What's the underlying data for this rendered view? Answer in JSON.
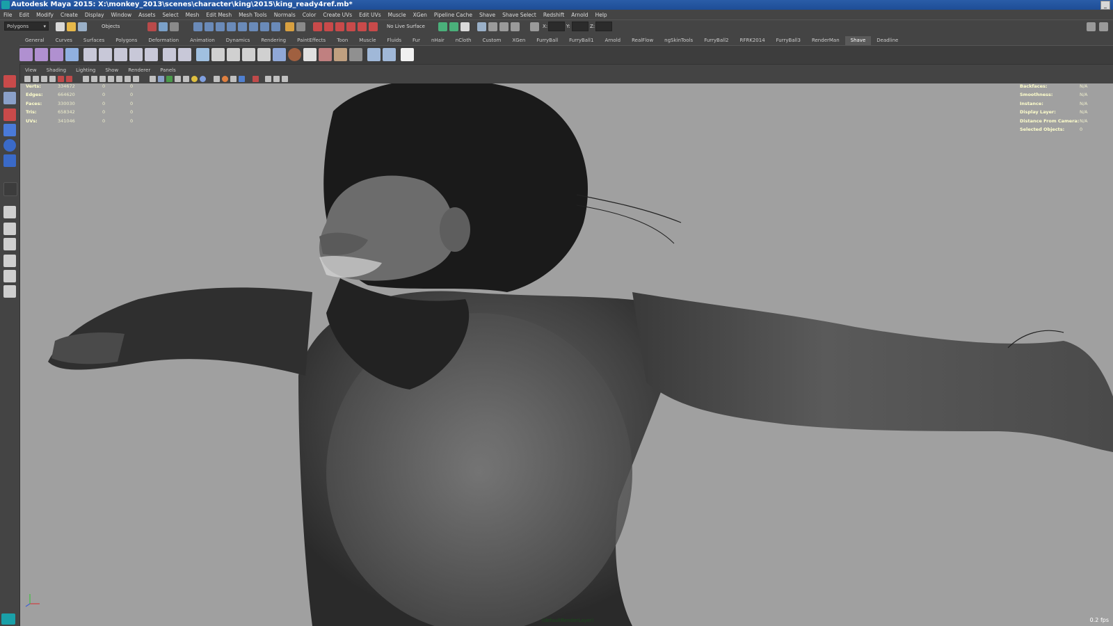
{
  "window": {
    "title": "Autodesk Maya 2015: X:\\monkey_2013\\scenes\\character\\king\\2015\\king_ready4ref.mb*"
  },
  "menu": [
    "File",
    "Edit",
    "Modify",
    "Create",
    "Display",
    "Window",
    "Assets",
    "Select",
    "Mesh",
    "Edit Mesh",
    "Mesh Tools",
    "Normals",
    "Color",
    "Create UVs",
    "Edit UVs",
    "Muscle",
    "XGen",
    "Pipeline Cache",
    "Shave",
    "Shave Select",
    "Redshift",
    "Arnold",
    "Help"
  ],
  "status_line": {
    "menuset": "Polygons",
    "selection_mode": "Objects",
    "live_surface": "No Live Surface",
    "x_label": "X:",
    "y_label": "Y:",
    "z_label": "Z:"
  },
  "shelf_tabs": [
    "General",
    "Curves",
    "Surfaces",
    "Polygons",
    "Deformation",
    "Animation",
    "Dynamics",
    "Rendering",
    "PaintEffects",
    "Toon",
    "Muscle",
    "Fluids",
    "Fur",
    "nHair",
    "nCloth",
    "Custom",
    "XGen",
    "FurryBall",
    "FurryBall1",
    "Arnold",
    "RealFlow",
    "ngSkinTools",
    "FurryBall2",
    "RFRK2014",
    "FurryBall3",
    "RenderMan",
    "Shave",
    "Deadline"
  ],
  "active_shelf": "Shave",
  "panel_menu": [
    "View",
    "Shading",
    "Lighting",
    "Show",
    "Renderer",
    "Panels"
  ],
  "hud_left": [
    {
      "label": "Verts:",
      "value": "334672",
      "c2": "0",
      "c3": "0"
    },
    {
      "label": "Edges:",
      "value": "664620",
      "c2": "0",
      "c3": "0"
    },
    {
      "label": "Faces:",
      "value": "330030",
      "c2": "0",
      "c3": "0"
    },
    {
      "label": "Tris:",
      "value": "658342",
      "c2": "0",
      "c3": "0"
    },
    {
      "label": "UVs:",
      "value": "341046",
      "c2": "0",
      "c3": "0"
    }
  ],
  "hud_right": [
    {
      "label": "Backfaces:",
      "value": "N/A"
    },
    {
      "label": "Smoothness:",
      "value": "N/A"
    },
    {
      "label": "Instance:",
      "value": "N/A"
    },
    {
      "label": "Display Layer:",
      "value": "N/A"
    },
    {
      "label": "Distance From Camera:",
      "value": "N/A"
    },
    {
      "label": "Selected Objects:",
      "value": "0"
    }
  ],
  "render_layer": "(defaultRenderLayer)",
  "fps": "0.2 fps",
  "colors": {
    "title_bar": "#1e4d96",
    "ui_bg": "#444444",
    "viewport_bg": "#a0a0a0",
    "hud_text": "#ffffcc"
  }
}
